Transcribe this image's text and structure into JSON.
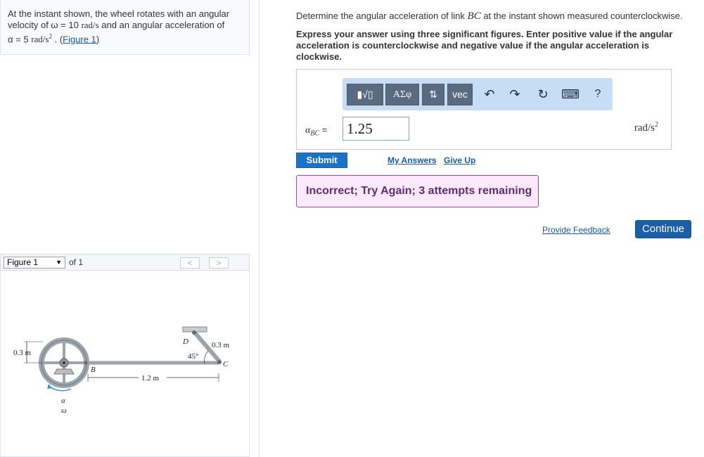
{
  "problem": {
    "line1": "At the instant shown, the wheel rotates with an angular",
    "line2_pre": "velocity of ω = 10 ",
    "line2_unit": "rad/s",
    "line2_post": " and an angular acceleration of",
    "line3_pre": "α = 5 ",
    "line3_unit": "rad/s",
    "line3_sup": "2",
    "line3_post": " . (",
    "figure_link": "Figure 1",
    "line3_close": ")"
  },
  "figure_nav": {
    "select_value": "Figure 1",
    "of_label": "of 1",
    "prev": "<",
    "next": ">"
  },
  "figure": {
    "radius_label": "0.3 m",
    "length_label": "1.2 m",
    "link_label": "0.3 m",
    "angle_label": "45°",
    "point_b": "B",
    "point_c": "C",
    "point_d": "D",
    "alpha": "α",
    "omega": "ω"
  },
  "question": {
    "pre": "Determine the angular acceleration of link ",
    "var": "BC",
    "post": " at the instant shown measured counterclockwise."
  },
  "instructions": "Express your answer using three significant figures. Enter positive value if the angular acceleration is counterclockwise and negative value if the angular acceleration is clockwise.",
  "toolbar": {
    "templates": "▮√▯",
    "greek": "ΑΣφ",
    "updown": "⇅",
    "vec": "vec",
    "undo": "↶",
    "redo": "↷",
    "reset": "↻",
    "keyboard": "⌨",
    "help": "?"
  },
  "answer": {
    "label_var": "α",
    "label_sub": "BC",
    "label_eq": " =",
    "value": "1.25",
    "unit": "rad/s",
    "unit_sup": "2"
  },
  "actions": {
    "submit": "Submit",
    "my_answers": "My Answers",
    "give_up": "Give Up",
    "feedback": "Incorrect; Try Again; 3 attempts remaining",
    "provide_feedback": "Provide Feedback",
    "continue": "Continue"
  }
}
